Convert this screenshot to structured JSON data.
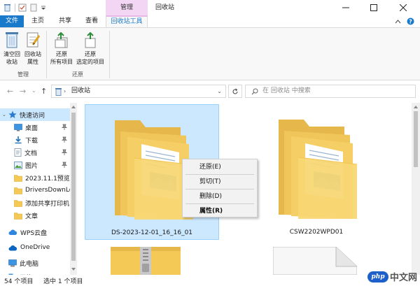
{
  "window": {
    "title": "回收站",
    "context_tab_top": "管理"
  },
  "ribbon_tabs": {
    "file": "文件",
    "home": "主页",
    "share": "共享",
    "view": "查看",
    "tools": "回收站工具"
  },
  "ribbon": {
    "empty_bin": [
      "清空回",
      "收站"
    ],
    "bin_props": [
      "回收站",
      "属性"
    ],
    "restore_all": [
      "还原",
      "所有项目"
    ],
    "restore_selected": [
      "还原",
      "选定的项目"
    ],
    "group_manage": "管理",
    "group_restore": "还原"
  },
  "address": {
    "path": "回收站",
    "search_placeholder": "在 回收站 中搜索"
  },
  "nav": {
    "items": [
      {
        "label": "快速访问"
      },
      {
        "label": "桌面"
      },
      {
        "label": "下载"
      },
      {
        "label": "文档"
      },
      {
        "label": "图片"
      },
      {
        "label": "2023.11.1预览正"
      },
      {
        "label": "DriversDownLo"
      },
      {
        "label": "添加共享打印机"
      },
      {
        "label": "文章"
      },
      {
        "label": "WPS云盘"
      },
      {
        "label": "OneDrive"
      },
      {
        "label": "此电脑"
      },
      {
        "label": "网络"
      }
    ]
  },
  "files": [
    {
      "name": "DS-2023-12-01_16_16_01"
    },
    {
      "name": "CSW2202WPD01"
    }
  ],
  "context_menu": {
    "restore": "还原(E)",
    "cut": "剪切(T)",
    "delete": "删除(D)",
    "properties": "属性(R)"
  },
  "status": {
    "count": "54 个项目",
    "selected": "选中 1 个项目"
  },
  "watermark": {
    "logo": "php",
    "text": "中文网"
  },
  "colors": {
    "accent": "#1979ca",
    "selection": "#cce8ff",
    "context_tab": "#f3d6f3",
    "folder": "#f5c955"
  }
}
